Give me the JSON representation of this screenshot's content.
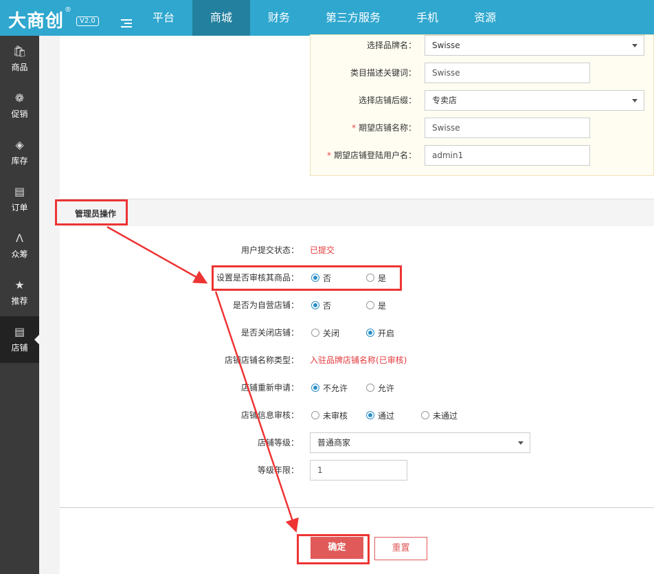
{
  "header": {
    "logo_text": "大商创",
    "logo_reg": "®",
    "version": "V2.0",
    "nav": [
      "平台",
      "商城",
      "财务",
      "第三方服务",
      "手机",
      "资源"
    ],
    "active_nav": "商城"
  },
  "sidebar": {
    "items": [
      {
        "label": "商品",
        "icon": "bag-icon"
      },
      {
        "label": "促销",
        "icon": "gift-icon"
      },
      {
        "label": "库存",
        "icon": "tag-icon"
      },
      {
        "label": "订单",
        "icon": "clipboard-icon"
      },
      {
        "label": "众筹",
        "icon": "crowd-icon"
      },
      {
        "label": "推荐",
        "icon": "star-icon"
      },
      {
        "label": "店铺",
        "icon": "shop-icon"
      }
    ],
    "active": "店铺"
  },
  "shop_info": {
    "brand_label": "选择品牌名：",
    "brand_value": "Swisse",
    "keyword_label": "类目描述关键词：",
    "keyword_value": "Swisse",
    "suffix_label": "选择店铺后缀：",
    "suffix_value": "专卖店",
    "shop_name_label": "期望店铺名称：",
    "shop_name_value": "Swisse",
    "login_label": "期望店铺登陆用户名：",
    "login_value": "admin1",
    "required_mark": "*"
  },
  "admin_section": {
    "title": "管理员操作",
    "submit_status_label": "用户提交状态：",
    "submit_status_value": "已提交",
    "review_goods_label": "设置是否审核其商品：",
    "review_goods_options": [
      "否",
      "是"
    ],
    "review_goods_selected": 0,
    "self_run_label": "是否为自营店铺：",
    "self_run_options": [
      "否",
      "是"
    ],
    "self_run_selected": 0,
    "close_shop_label": "是否关闭店铺：",
    "close_shop_options": [
      "关闭",
      "开启"
    ],
    "close_shop_selected": 1,
    "name_type_label": "店铺店铺名称类型：",
    "name_type_value": "入驻品牌店铺名称(已审核)",
    "reapply_label": "店铺重新申请：",
    "reapply_options": [
      "不允许",
      "允许"
    ],
    "reapply_selected": 0,
    "info_review_label": "店铺信息审核：",
    "info_review_options": [
      "未审核",
      "通过",
      "未通过"
    ],
    "info_review_selected": 1,
    "grade_label": "店铺等级：",
    "grade_value": "普通商家",
    "years_label": "等级年限：",
    "years_value": "1"
  },
  "buttons": {
    "confirm": "确定",
    "reset": "重置"
  },
  "colors": {
    "topbar": "#2fa7cf",
    "active_nav": "#23809f",
    "sidebar": "#3a3a3a",
    "accent_red": "#e4393c",
    "annotation": "#e33"
  }
}
